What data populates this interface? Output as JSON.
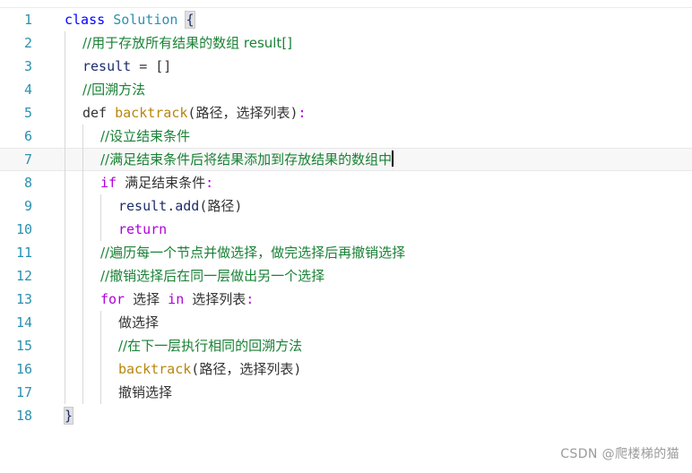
{
  "editor": {
    "language": "python",
    "gutter_color": "#2b91af",
    "comment_color": "#1a8236",
    "keyword_color": "#af00db",
    "class_keyword_color": "#0000ff",
    "type_color": "#2b91af",
    "function_color": "#b8860b",
    "identifier_color": "#1c2d6b",
    "active_line": 7,
    "active_line_bg": "#f7f7f7",
    "caret_line": 7,
    "background": "#ffffff",
    "line_numbers": [
      "1",
      "2",
      "3",
      "4",
      "5",
      "6",
      "7",
      "8",
      "9",
      "10",
      "11",
      "12",
      "13",
      "14",
      "15",
      "16",
      "17",
      "18"
    ],
    "lines": [
      {
        "n": "1",
        "indent": 0,
        "guides": 0,
        "tokens": [
          {
            "t": "class",
            "c": "kw-blue"
          },
          {
            "t": " ",
            "c": "plain"
          },
          {
            "t": "Solution",
            "c": "type"
          },
          {
            "t": " ",
            "c": "plain"
          },
          {
            "t": "{",
            "c": "bracket"
          }
        ]
      },
      {
        "n": "2",
        "indent": 1,
        "guides": 1,
        "tokens": [
          {
            "t": "//用于存放所有结果的数组 result[]",
            "c": "comment"
          }
        ]
      },
      {
        "n": "3",
        "indent": 1,
        "guides": 1,
        "tokens": [
          {
            "t": "result",
            "c": "ident"
          },
          {
            "t": " = ",
            "c": "plain"
          },
          {
            "t": "[]",
            "c": "plain"
          }
        ]
      },
      {
        "n": "4",
        "indent": 1,
        "guides": 1,
        "tokens": [
          {
            "t": "//回溯方法",
            "c": "comment"
          }
        ]
      },
      {
        "n": "5",
        "indent": 1,
        "guides": 1,
        "tokens": [
          {
            "t": "def",
            "c": "plain"
          },
          {
            "t": " ",
            "c": "plain"
          },
          {
            "t": "backtrack",
            "c": "fn"
          },
          {
            "t": "(",
            "c": "plain"
          },
          {
            "t": "路径，选择列表",
            "c": "plain"
          },
          {
            "t": ")",
            "c": "plain"
          },
          {
            "t": ":",
            "c": "kw-mag"
          }
        ]
      },
      {
        "n": "6",
        "indent": 2,
        "guides": 2,
        "tokens": [
          {
            "t": "//设立结束条件",
            "c": "comment"
          }
        ]
      },
      {
        "n": "7",
        "indent": 2,
        "guides": 2,
        "caret": true,
        "tokens": [
          {
            "t": "//满足结束条件后将结果添加到存放结果的数组中",
            "c": "comment"
          }
        ]
      },
      {
        "n": "8",
        "indent": 2,
        "guides": 2,
        "tokens": [
          {
            "t": "if",
            "c": "kw-mag"
          },
          {
            "t": " ",
            "c": "plain"
          },
          {
            "t": "满足结束条件",
            "c": "plain"
          },
          {
            "t": ":",
            "c": "kw-mag"
          }
        ]
      },
      {
        "n": "9",
        "indent": 3,
        "guides": 3,
        "tokens": [
          {
            "t": "result",
            "c": "ident"
          },
          {
            "t": ".",
            "c": "plain"
          },
          {
            "t": "add",
            "c": "ident"
          },
          {
            "t": "(",
            "c": "plain"
          },
          {
            "t": "路径",
            "c": "plain"
          },
          {
            "t": ")",
            "c": "plain"
          }
        ]
      },
      {
        "n": "10",
        "indent": 3,
        "guides": 3,
        "tokens": [
          {
            "t": "return",
            "c": "kw-mag"
          }
        ]
      },
      {
        "n": "11",
        "indent": 2,
        "guides": 2,
        "tokens": [
          {
            "t": "//遍历每一个节点并做选择，做完选择后再撤销选择",
            "c": "comment"
          }
        ]
      },
      {
        "n": "12",
        "indent": 2,
        "guides": 2,
        "tokens": [
          {
            "t": "//撤销选择后在同一层做出另一个选择",
            "c": "comment"
          }
        ]
      },
      {
        "n": "13",
        "indent": 2,
        "guides": 2,
        "tokens": [
          {
            "t": "for",
            "c": "kw-mag"
          },
          {
            "t": " ",
            "c": "plain"
          },
          {
            "t": "选择",
            "c": "plain"
          },
          {
            "t": " ",
            "c": "plain"
          },
          {
            "t": "in",
            "c": "kw-mag"
          },
          {
            "t": " ",
            "c": "plain"
          },
          {
            "t": "选择列表",
            "c": "plain"
          },
          {
            "t": ":",
            "c": "kw-mag"
          }
        ]
      },
      {
        "n": "14",
        "indent": 3,
        "guides": 3,
        "tokens": [
          {
            "t": "做选择",
            "c": "plain"
          }
        ]
      },
      {
        "n": "15",
        "indent": 3,
        "guides": 3,
        "tokens": [
          {
            "t": "//在下一层执行相同的回溯方法",
            "c": "comment"
          }
        ]
      },
      {
        "n": "16",
        "indent": 3,
        "guides": 3,
        "tokens": [
          {
            "t": "backtrack",
            "c": "fn"
          },
          {
            "t": "(",
            "c": "plain"
          },
          {
            "t": "路径，选择列表",
            "c": "plain"
          },
          {
            "t": ")",
            "c": "plain"
          }
        ]
      },
      {
        "n": "17",
        "indent": 3,
        "guides": 3,
        "tokens": [
          {
            "t": "撤销选择",
            "c": "plain"
          }
        ]
      },
      {
        "n": "18",
        "indent": 0,
        "guides": 0,
        "tokens": [
          {
            "t": "}",
            "c": "bracket"
          }
        ]
      }
    ]
  },
  "watermark": {
    "text": "CSDN @爬楼梯的猫",
    "color": "#9b9b9b"
  }
}
